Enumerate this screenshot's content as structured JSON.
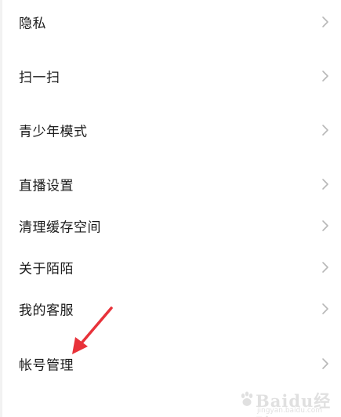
{
  "settings": {
    "items": [
      {
        "label": "隐私"
      },
      {
        "label": "扫一扫"
      },
      {
        "label": "青少年模式"
      },
      {
        "label": "直播设置"
      },
      {
        "label": "清理缓存空间"
      },
      {
        "label": "关于陌陌"
      },
      {
        "label": "我的客服"
      },
      {
        "label": "帐号管理"
      }
    ]
  },
  "annotation": {
    "arrow_color": "#e8323a"
  },
  "watermark": {
    "brand": "Baidu经验",
    "url": "jingyan.baidu.com"
  },
  "colors": {
    "text": "#1a1a1a",
    "chevron": "#b8b8b8",
    "background": "#ffffff"
  }
}
